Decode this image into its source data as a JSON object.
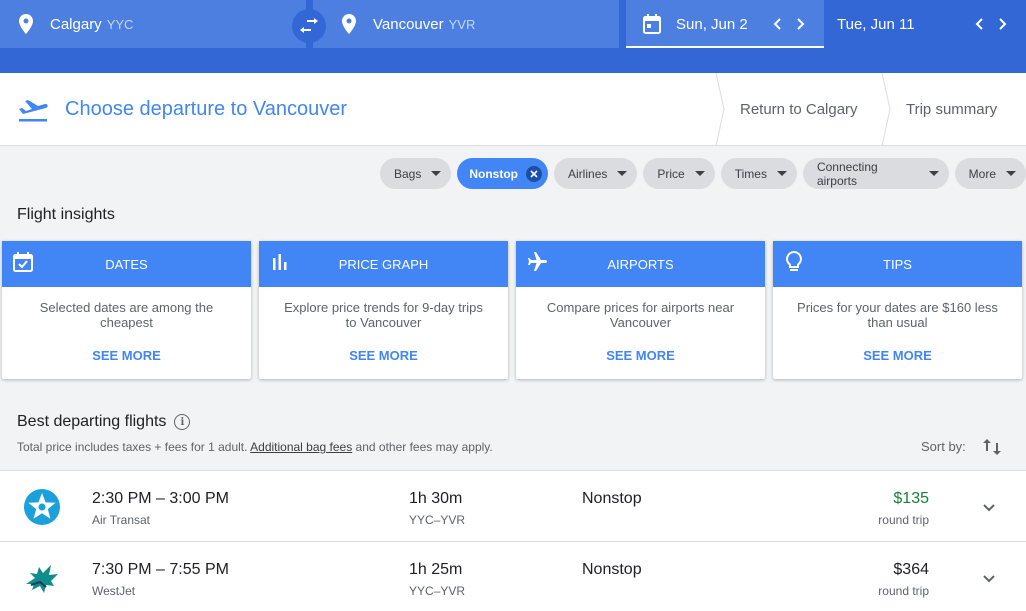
{
  "search": {
    "origin": {
      "city": "Calgary",
      "code": "YYC"
    },
    "destination": {
      "city": "Vancouver",
      "code": "YVR"
    },
    "depart_date": "Sun, Jun 2",
    "return_date": "Tue, Jun 11"
  },
  "step": {
    "title": "Choose departure to Vancouver",
    "crumbs": [
      "Return to Calgary",
      "Trip summary"
    ]
  },
  "filters": [
    "Bags",
    "Nonstop",
    "Airlines",
    "Price",
    "Times",
    "Connecting airports",
    "More"
  ],
  "insights": {
    "title": "Flight insights",
    "cards": [
      {
        "icon": "calendar-check-icon",
        "title": "DATES",
        "text": "Selected dates are among the cheapest",
        "action": "SEE MORE"
      },
      {
        "icon": "bar-chart-icon",
        "title": "PRICE GRAPH",
        "text": "Explore price trends for 9-day trips to Vancouver",
        "action": "SEE MORE"
      },
      {
        "icon": "airplane-icon",
        "title": "AIRPORTS",
        "text": "Compare prices for airports near Vancouver",
        "action": "SEE MORE"
      },
      {
        "icon": "lightbulb-icon",
        "title": "TIPS",
        "text": "Prices for your dates are $160 less than usual",
        "action": "SEE MORE"
      }
    ]
  },
  "best": {
    "title": "Best departing flights",
    "note_before": "Total price includes taxes + fees for 1 adult. ",
    "note_link": "Additional bag fees",
    "note_after": " and other fees may apply.",
    "sort_label": "Sort by:"
  },
  "flights": [
    {
      "time": "2:30 PM – 3:00 PM",
      "airline": "Air Transat",
      "duration": "1h 30m",
      "route": "YYC–YVR",
      "stops": "Nonstop",
      "price": "$135",
      "price_type": "round trip",
      "logo": "air-transat-logo"
    },
    {
      "time": "7:30 PM – 7:55 PM",
      "airline": "WestJet",
      "duration": "1h 25m",
      "route": "YYC–YVR",
      "stops": "Nonstop",
      "price": "$364",
      "price_type": "round trip",
      "logo": "westjet-logo"
    }
  ],
  "colors": {
    "header_blue": "#3367d6",
    "accent_blue": "#4285f4",
    "cheap_price": "#188038"
  }
}
